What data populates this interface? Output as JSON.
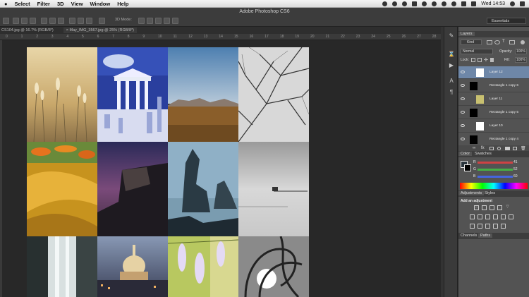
{
  "menubar": {
    "items": [
      "Select",
      "Filter",
      "3D",
      "View",
      "Window",
      "Help"
    ],
    "clock": "Wed 14:53"
  },
  "app": {
    "title": "Adobe Photoshop CS6",
    "mode_3d": "3D Mode:",
    "workspace": "Essentials"
  },
  "doc_tabs": [
    {
      "label": "CS104.jpg @ 16.7% (RGB/8*)"
    },
    {
      "label": "×  May_IMG_3567.jpg @ 25% (RGB/8*)"
    }
  ],
  "ruler": {
    "numbers": [
      "0",
      "1",
      "2",
      "3",
      "4",
      "5",
      "6",
      "7",
      "8",
      "9",
      "10",
      "11",
      "12",
      "13",
      "14",
      "15",
      "16",
      "17",
      "18",
      "19",
      "20",
      "21",
      "22",
      "23",
      "24",
      "25",
      "26",
      "27",
      "28"
    ]
  },
  "icons": [
    "brush-icon",
    "history-icon",
    "actions-icon",
    "char-icon",
    "para-icon"
  ],
  "layers_panel": {
    "tab": "Layers",
    "kind": "Kind",
    "blend_mode": "Normal",
    "opacity_label": "Opacity:",
    "opacity": "100%",
    "lock_label": "Lock:",
    "fill_label": "Fill:",
    "fill": "100%",
    "layers": [
      {
        "name": "Layer 12",
        "selected": true,
        "thumb": "white"
      },
      {
        "name": "Rectangle 1 copy 6",
        "selected": false,
        "thumb": "black"
      },
      {
        "name": "Layer 11",
        "selected": false,
        "thumb": "photo"
      },
      {
        "name": "Rectangle 1 copy 5",
        "selected": false,
        "thumb": "black"
      },
      {
        "name": "Layer 10",
        "selected": false,
        "thumb": "white"
      },
      {
        "name": "Rectangle 1 copy 4",
        "selected": false,
        "thumb": "black"
      }
    ]
  },
  "color_panel": {
    "tabs": [
      "Color",
      "Swatches"
    ],
    "channels": [
      {
        "label": "R",
        "value": "41",
        "color": "#e04545"
      },
      {
        "label": "G",
        "value": "52",
        "color": "#45b045"
      },
      {
        "label": "B",
        "value": "60",
        "color": "#4565e0"
      }
    ]
  },
  "adjustments_panel": {
    "tabs": [
      "Adjustments",
      "Styles"
    ],
    "heading": "Add an adjustment"
  },
  "bottom_panel": {
    "tabs": [
      "Channels",
      "Paths"
    ]
  }
}
